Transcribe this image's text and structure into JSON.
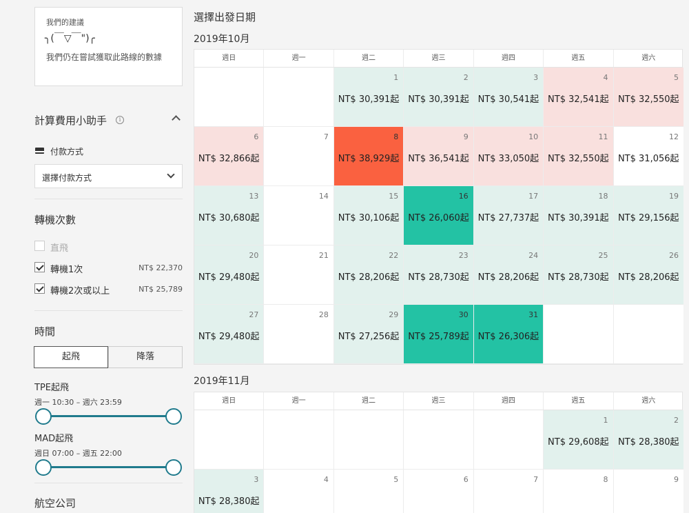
{
  "sidebar": {
    "suggestion": {
      "title": "我們的建議",
      "face": "╮(￣▽￣\")╭",
      "text": "我們仍在嘗試獲取此路線的數據"
    },
    "calculator": {
      "title": "計算費用小助手",
      "info_icon": "info-icon",
      "payment_label": "付款方式",
      "payment_placeholder": "選擇付款方式"
    },
    "stops": {
      "title": "轉機次數",
      "options": [
        {
          "label": "直飛",
          "checked": false,
          "disabled": true,
          "price": ""
        },
        {
          "label": "轉機1次",
          "checked": true,
          "disabled": false,
          "price": "NT$ 22,370"
        },
        {
          "label": "轉機2次或以上",
          "checked": true,
          "disabled": false,
          "price": "NT$ 25,789"
        }
      ]
    },
    "time": {
      "title": "時間",
      "tabs": [
        "起飛",
        "降落"
      ],
      "active_tab": 0,
      "ranges": [
        {
          "title": "TPE起飛",
          "sub": "週一 10:30 – 週六 23:59"
        },
        {
          "title": "MAD起飛",
          "sub": "週日 07:00 – 週五 22:00"
        }
      ]
    },
    "airlines": {
      "title": "航空公司"
    }
  },
  "main": {
    "title": "選擇出發日期",
    "weekdays": [
      "週日",
      "週一",
      "週二",
      "週三",
      "週四",
      "週五",
      "週六"
    ],
    "colors": {
      "green": "#e2f1ed",
      "pink": "#f9e0de",
      "teal": "#23c2a4",
      "red": "#fa6140",
      "slider": "#1f7a8c"
    },
    "months": [
      {
        "label": "2019年10月",
        "weeks": [
          [
            {
              "day": "",
              "price": "",
              "tone": ""
            },
            {
              "day": "",
              "price": "",
              "tone": ""
            },
            {
              "day": "1",
              "price": "NT$ 30,391起",
              "tone": "green"
            },
            {
              "day": "2",
              "price": "NT$ 30,391起",
              "tone": "green"
            },
            {
              "day": "3",
              "price": "NT$ 30,541起",
              "tone": "green"
            },
            {
              "day": "4",
              "price": "NT$ 32,541起",
              "tone": "pink"
            },
            {
              "day": "5",
              "price": "NT$ 32,550起",
              "tone": "pink"
            }
          ],
          [
            {
              "day": "6",
              "price": "NT$ 32,866起",
              "tone": "pink"
            },
            {
              "day": "7",
              "price": "",
              "tone": ""
            },
            {
              "day": "8",
              "price": "NT$ 38,929起",
              "tone": "red"
            },
            {
              "day": "9",
              "price": "NT$ 36,541起",
              "tone": "pink"
            },
            {
              "day": "10",
              "price": "NT$ 33,050起",
              "tone": "pink"
            },
            {
              "day": "11",
              "price": "NT$ 32,550起",
              "tone": "pink"
            },
            {
              "day": "12",
              "price": "NT$ 31,056起",
              "tone": ""
            }
          ],
          [
            {
              "day": "13",
              "price": "NT$ 30,680起",
              "tone": "green"
            },
            {
              "day": "14",
              "price": "",
              "tone": ""
            },
            {
              "day": "15",
              "price": "NT$ 30,106起",
              "tone": "green"
            },
            {
              "day": "16",
              "price": "NT$ 26,060起",
              "tone": "teal"
            },
            {
              "day": "17",
              "price": "NT$ 27,737起",
              "tone": "green"
            },
            {
              "day": "18",
              "price": "NT$ 30,391起",
              "tone": "green"
            },
            {
              "day": "19",
              "price": "NT$ 29,156起",
              "tone": "green"
            }
          ],
          [
            {
              "day": "20",
              "price": "NT$ 29,480起",
              "tone": "green"
            },
            {
              "day": "21",
              "price": "",
              "tone": ""
            },
            {
              "day": "22",
              "price": "NT$ 28,206起",
              "tone": "green"
            },
            {
              "day": "23",
              "price": "NT$ 28,730起",
              "tone": "green"
            },
            {
              "day": "24",
              "price": "NT$ 28,206起",
              "tone": "green"
            },
            {
              "day": "25",
              "price": "NT$ 28,730起",
              "tone": "green"
            },
            {
              "day": "26",
              "price": "NT$ 28,206起",
              "tone": "green"
            }
          ],
          [
            {
              "day": "27",
              "price": "NT$ 29,480起",
              "tone": "green"
            },
            {
              "day": "28",
              "price": "",
              "tone": ""
            },
            {
              "day": "29",
              "price": "NT$ 27,256起",
              "tone": "green"
            },
            {
              "day": "30",
              "price": "NT$ 25,789起",
              "tone": "teal"
            },
            {
              "day": "31",
              "price": "NT$ 26,306起",
              "tone": "teal"
            },
            {
              "day": "",
              "price": "",
              "tone": ""
            },
            {
              "day": "",
              "price": "",
              "tone": ""
            }
          ]
        ]
      },
      {
        "label": "2019年11月",
        "weeks": [
          [
            {
              "day": "",
              "price": "",
              "tone": ""
            },
            {
              "day": "",
              "price": "",
              "tone": ""
            },
            {
              "day": "",
              "price": "",
              "tone": ""
            },
            {
              "day": "",
              "price": "",
              "tone": ""
            },
            {
              "day": "",
              "price": "",
              "tone": ""
            },
            {
              "day": "1",
              "price": "NT$ 29,608起",
              "tone": "green"
            },
            {
              "day": "2",
              "price": "NT$ 28,380起",
              "tone": "green"
            }
          ],
          [
            {
              "day": "3",
              "price": "NT$ 28,380起",
              "tone": "green"
            },
            {
              "day": "4",
              "price": "",
              "tone": ""
            },
            {
              "day": "5",
              "price": "",
              "tone": ""
            },
            {
              "day": "6",
              "price": "",
              "tone": ""
            },
            {
              "day": "7",
              "price": "",
              "tone": ""
            },
            {
              "day": "8",
              "price": "",
              "tone": ""
            },
            {
              "day": "9",
              "price": "",
              "tone": ""
            }
          ]
        ]
      }
    ]
  }
}
